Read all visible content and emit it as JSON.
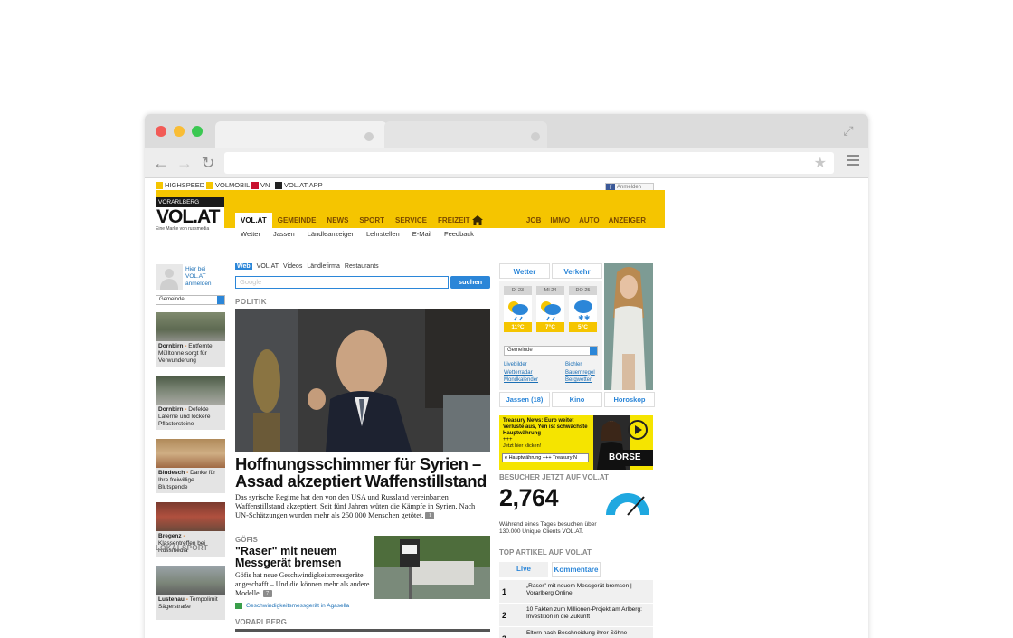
{
  "topbar": {
    "links": [
      "HIGHSPEED",
      "VOLMOBIL",
      "VN",
      "VOL.AT APP"
    ],
    "login_label": "Anmelden"
  },
  "logo": {
    "top": "VORARLBERG ONLINE",
    "main": "VOL.AT",
    "sub": "Eine Marke von russmedia"
  },
  "mainnav": [
    "VOL.AT",
    "GEMEINDE",
    "NEWS",
    "SPORT",
    "SERVICE",
    "FREIZEIT"
  ],
  "rightnav": [
    "JOB",
    "IMMO",
    "AUTO",
    "ANZEIGER"
  ],
  "subnav": [
    "Wetter",
    "Jassen",
    "Ländleanzeiger",
    "Lehrstellen",
    "E-Mail",
    "Feedback"
  ],
  "leftcol": {
    "login_text": "Hier bei VOL.AT anmelden",
    "gemeinde": "Gemeinde",
    "news": [
      {
        "place": "Dornbirn",
        "text": "Entfernte Mülltonne sorgt für Verwunderung"
      },
      {
        "place": "Dornbirn",
        "text": "Defekte Laterne und lockere Pflastersteine"
      },
      {
        "place": "Bludesch",
        "text": "Danke für Ihre freiwillige Blutspende"
      },
      {
        "place": "Bregenz",
        "text": "Klassentreffen bei Russmedia"
      },
      {
        "place": "Lustenau",
        "text": "Tempolimit Sägerstraße"
      }
    ],
    "lokalsport": "LOKALSPORT"
  },
  "search": {
    "tabs": [
      "Web",
      "VOL.AT",
      "Videos",
      "Ländlefirma",
      "Restaurants"
    ],
    "placeholder": "Google",
    "button": "suchen"
  },
  "main": {
    "section": "POLITIK",
    "hero_title": "Hoffnungsschimmer für Syrien – Assad akzeptiert Waffenstillstand",
    "hero_teaser": "Das syrische Regime hat den von den USA und Russland vereinbarten Waffenstillstand akzeptiert. Seit fünf Jahren wüten die Kämpfe in Syrien. Nach UN-Schätzungen wurden mehr als 250 000 Menschen getötet.",
    "hero_tag": "1",
    "story2_label": "GÖFIS",
    "story2_title": "\"Raser\" mit neuem Messgerät bremsen",
    "story2_text": "Göfis hat neue Geschwindigkeitsmessgeräte angeschafft – Und die können mehr als andere Modelle.",
    "story2_tag": "7",
    "story2_link": "Geschwindigkeitsmessgerät in Agasella",
    "section2": "VORARLBERG"
  },
  "weather": {
    "tabs": [
      "Wetter",
      "Verkehr"
    ],
    "days": [
      {
        "label": "DI 23",
        "temp": "11°C"
      },
      {
        "label": "MI 24",
        "temp": "7°C"
      },
      {
        "label": "DO 25",
        "temp": "5°C"
      }
    ],
    "gemeinde": "Gemeinde",
    "links_left": [
      "Livebilder",
      "Wetterradar",
      "Mondkalender"
    ],
    "links_right": [
      "Bichler",
      "Bauernregel",
      "Bergwetter"
    ]
  },
  "quick": [
    "Jassen (18)",
    "Kino",
    "Horoskop"
  ],
  "ad": {
    "headline": "Treasury News: Euro weitet Verluste aus, Yen ist schwächste Hauptwährung",
    "plus": "+++",
    "cta": "Jetzt hier klicken!",
    "ticker": "e Hauptwährung +++ Treasury N",
    "brand": "BÖRSE"
  },
  "besucher": {
    "label": "BESUCHER JETZT AUF VOL.AT",
    "count": "2,764",
    "text": "Während eines Tages besuchen über 130.000 Unique Clients VOL.AT."
  },
  "top": {
    "label": "TOP ARTIKEL AUF VOL.AT",
    "tabs": [
      "Live",
      "Kommentare"
    ],
    "items": [
      {
        "num": "1",
        "text": "„Raser\" mit neuem Messgerät bremsen | Vorarlberg Online"
      },
      {
        "num": "2",
        "text": "10 Fakten zum Millionen-Projekt am Arlberg: Investition in die Zukunft |"
      },
      {
        "num": "3",
        "text": "Eltern nach Beschneidung ihrer Söhne"
      }
    ]
  },
  "colors": {
    "brand_yellow": "#f5c500",
    "link_blue": "#1b6fb5",
    "accent_blue": "#2b86d8"
  }
}
